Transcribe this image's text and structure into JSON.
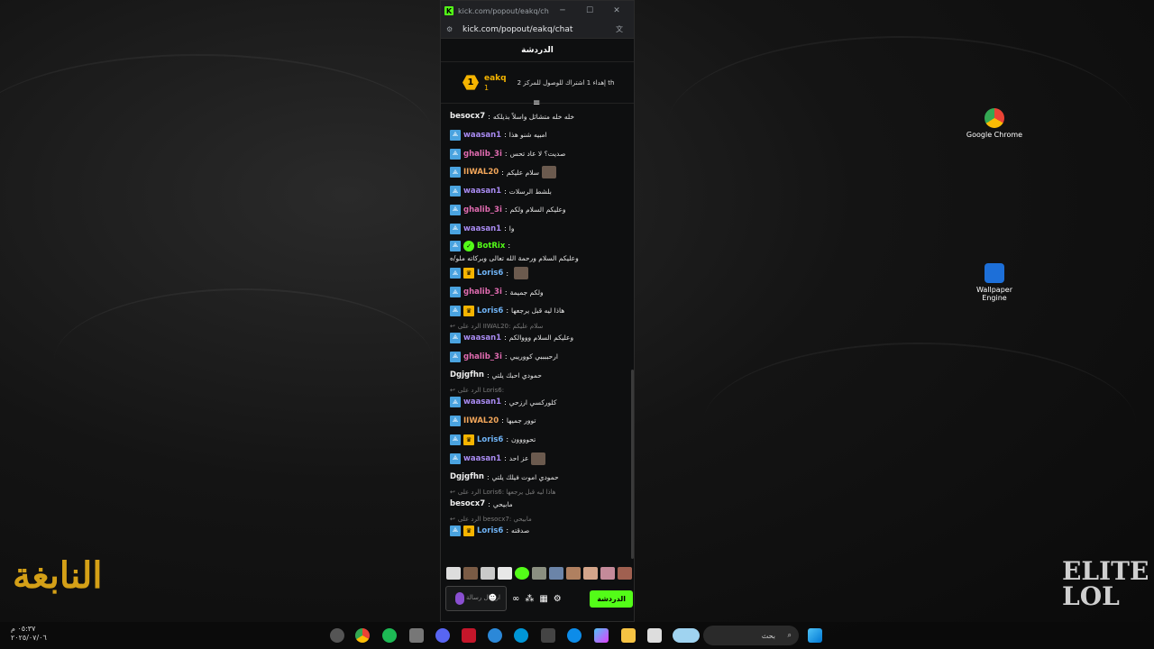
{
  "window": {
    "title": "kick.com/popout/eakq/chat...",
    "url": "kick.com/popout/eakq/chat",
    "chat_header": "الدردشة"
  },
  "pinned": {
    "username": "eakq",
    "rank": "1",
    "count": "1",
    "goal_text": "إهداء 1 اشتراك للوصول للمركز 2 th"
  },
  "messages": [
    {
      "user": "besocx7",
      "color": "#f0f0f0",
      "text": "خله خله متشائل واسلاً بذيلكه",
      "badges": []
    },
    {
      "user": "waasan1",
      "color": "#a98bf2",
      "text": "امبيه شنو هذا",
      "badges": [
        "blue"
      ]
    },
    {
      "user": "ghalib_3i",
      "color": "#e06bb0",
      "text": "صديت؟ لا عاد تحس",
      "badges": [
        "blue"
      ]
    },
    {
      "user": "IIWAL20",
      "color": "#f2a65a",
      "text": "سلام عليكم",
      "badges": [
        "blue"
      ],
      "emote": true
    },
    {
      "user": "waasan1",
      "color": "#a98bf2",
      "text": "بلشط الرسلات",
      "badges": [
        "blue"
      ]
    },
    {
      "user": "ghalib_3i",
      "color": "#e06bb0",
      "text": "وعليكم السلام ولكم",
      "badges": [
        "blue"
      ]
    },
    {
      "user": "waasan1",
      "color": "#a98bf2",
      "text": "وا",
      "badges": [
        "blue"
      ]
    },
    {
      "user": "BotRix",
      "color": "#53fc18",
      "text": "وعليكم السلام ورحمة الله تعالى وبركاته ملو/ه",
      "badges": [
        "blue",
        "green"
      ]
    },
    {
      "user": "Loris6",
      "color": "#6fb3f5",
      "text": "",
      "badges": [
        "blue",
        "gold"
      ],
      "emote": true
    },
    {
      "user": "ghalib_3i",
      "color": "#e06bb0",
      "text": "ولكم جميمة",
      "badges": [
        "blue"
      ]
    },
    {
      "user": "Loris6",
      "color": "#6fb3f5",
      "text": "هاذا ليه قبل يرجعها",
      "badges": [
        "blue",
        "gold"
      ]
    },
    {
      "user": "waasan1",
      "color": "#a98bf2",
      "text": "وعليكم السلام وووالكم",
      "badges": [
        "blue"
      ],
      "reply": "الرد على IIWAL20: سلام عليكم"
    },
    {
      "user": "ghalib_3i",
      "color": "#e06bb0",
      "text": "ارحببببي كووريبي",
      "badges": [
        "blue"
      ]
    },
    {
      "user": "Dgjgfhn",
      "color": "#f0f0f0",
      "text": "حمودي احبك يلتي",
      "badges": []
    },
    {
      "user": "waasan1",
      "color": "#a98bf2",
      "text": "كلوركسي ارزحي",
      "badges": [
        "blue"
      ],
      "reply": "الرد على Loris6:"
    },
    {
      "user": "IIWAL20",
      "color": "#f2a65a",
      "text": "توور جميها",
      "badges": [
        "blue"
      ]
    },
    {
      "user": "Loris6",
      "color": "#6fb3f5",
      "text": "تحوووون",
      "badges": [
        "blue",
        "gold"
      ]
    },
    {
      "user": "waasan1",
      "color": "#a98bf2",
      "text": "عز احد",
      "badges": [
        "blue"
      ],
      "emote": true
    },
    {
      "user": "Dgjgfhn",
      "color": "#f0f0f0",
      "text": "حمودي اموت فيلك يلتي",
      "badges": []
    },
    {
      "user": "besocx7",
      "color": "#f0f0f0",
      "text": "مابيحي",
      "badges": [],
      "reply": "الرد على Loris6: هاذا ليه قبل يرجعها"
    },
    {
      "user": "Loris6",
      "color": "#6fb3f5",
      "text": "صدقته",
      "badges": [
        "blue",
        "gold"
      ],
      "reply": "الرد على besocx7: مابيحي"
    }
  ],
  "input": {
    "placeholder": "ارسال رسالة",
    "send_label": "الدردشة"
  },
  "desktop": {
    "chrome_label": "Google Chrome",
    "wallpaper_label": "Wallpaper Engine"
  },
  "taskbar": {
    "search_text": "بحث",
    "time": "٠٥:٣٧ م",
    "date": "٢٠٢٥/٠٧/٠٦"
  },
  "logos": {
    "left_text": "النابغة",
    "right_text": "ELITE LOL"
  }
}
